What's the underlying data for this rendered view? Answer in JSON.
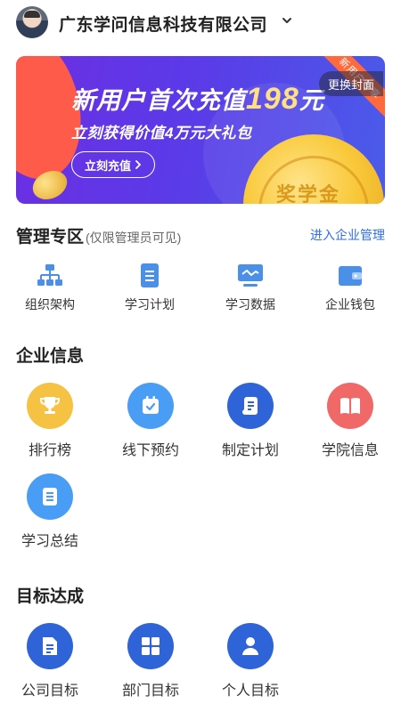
{
  "header": {
    "company_name": "广东学问信息科技有限公司"
  },
  "banner": {
    "title_prefix": "新用户首次充值",
    "title_amount": "198",
    "title_suffix": "元",
    "subtitle": "立刻获得价值4万元大礼包",
    "button_label": "立刻充值",
    "ribbon_text": "新用户专享",
    "change_cover_label": "更换封面",
    "coin_text": "奖学金"
  },
  "management": {
    "title": "管理专区",
    "note": "(仅限管理员可见)",
    "link": "进入企业管理",
    "items": [
      {
        "label": "组织架构",
        "icon": "org-chart-icon"
      },
      {
        "label": "学习计划",
        "icon": "document-icon"
      },
      {
        "label": "学习数据",
        "icon": "monitor-chart-icon"
      },
      {
        "label": "企业钱包",
        "icon": "wallet-icon"
      }
    ]
  },
  "enterprise": {
    "title": "企业信息",
    "items": [
      {
        "label": "排行榜",
        "icon": "trophy-icon",
        "color": "#f6c244"
      },
      {
        "label": "线下预约",
        "icon": "calendar-check-icon",
        "color": "#4a9df5"
      },
      {
        "label": "制定计划",
        "icon": "scroll-icon",
        "color": "#2f63d8"
      },
      {
        "label": "学院信息",
        "icon": "book-icon",
        "color": "#f06868"
      },
      {
        "label": "学习总结",
        "icon": "summary-doc-icon",
        "color": "#4a9df5"
      }
    ]
  },
  "goals": {
    "title": "目标达成",
    "items": [
      {
        "label": "公司目标",
        "icon": "company-doc-icon",
        "color": "#2f63d8"
      },
      {
        "label": "部门目标",
        "icon": "grid-icon",
        "color": "#2f63d8"
      },
      {
        "label": "个人目标",
        "icon": "person-icon",
        "color": "#2f63d8"
      }
    ]
  }
}
